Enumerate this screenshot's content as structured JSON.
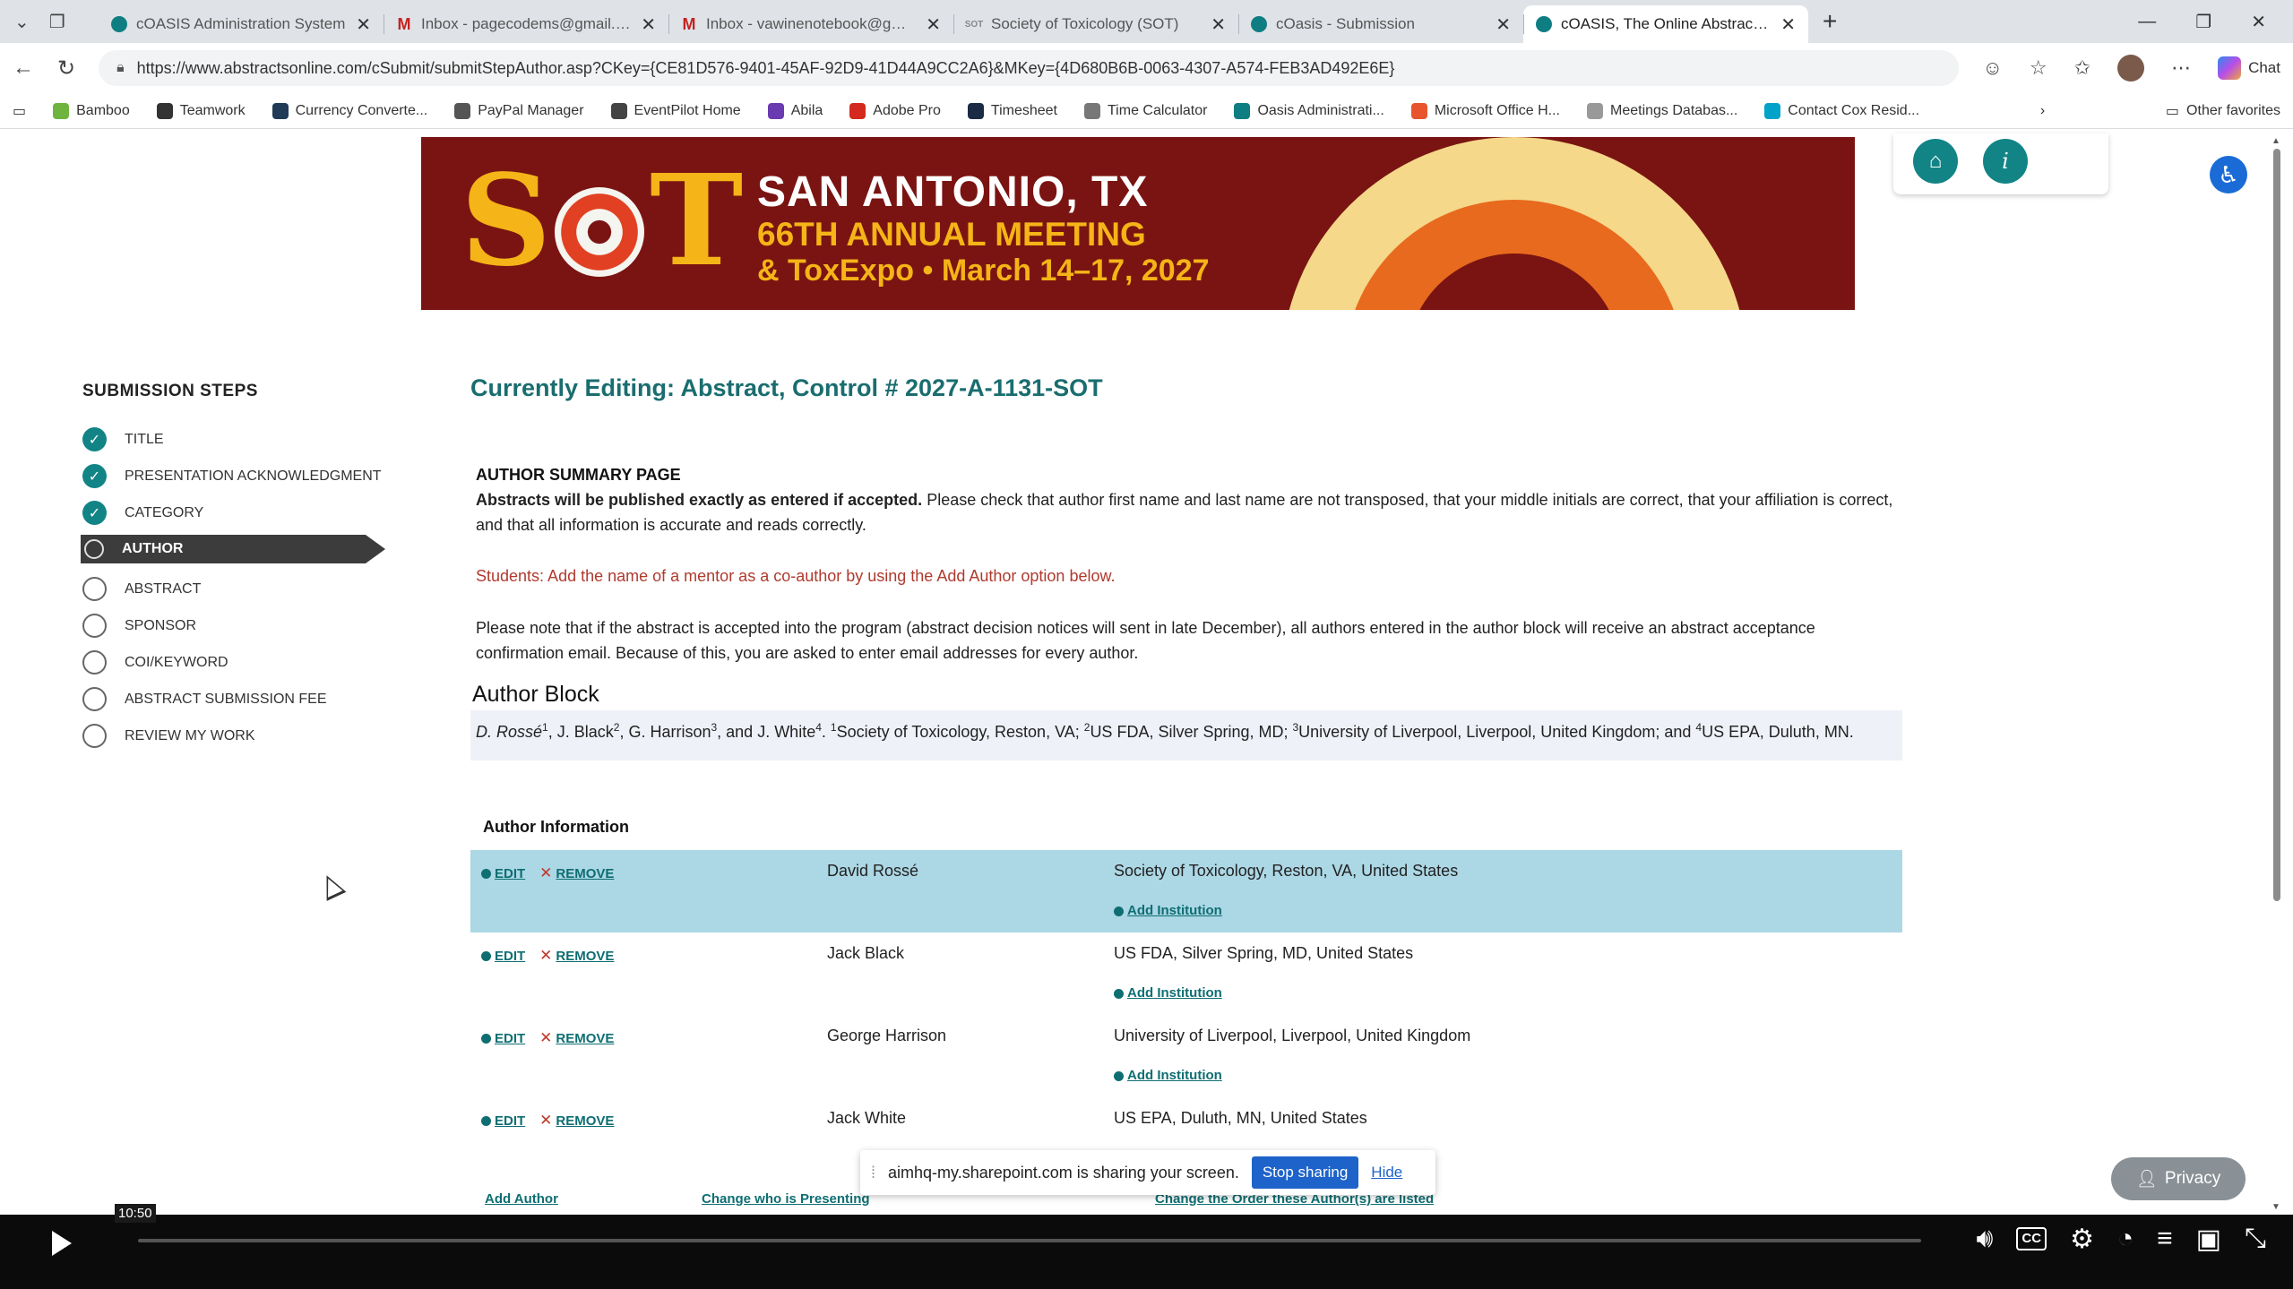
{
  "browser": {
    "tabs": [
      {
        "title": "cOASIS Administration System",
        "icon": "oasis-icon",
        "active": false
      },
      {
        "title": "Inbox - pagecodems@gmail.com",
        "icon": "gmail-icon",
        "active": false
      },
      {
        "title": "Inbox - vawinenotebook@gmail.c",
        "icon": "gmail-icon",
        "active": false
      },
      {
        "title": "Society of Toxicology (SOT)",
        "icon": "sot-icon",
        "active": false
      },
      {
        "title": "cOasis - Submission",
        "icon": "oasis-icon",
        "active": false
      },
      {
        "title": "cOASIS, The Online Abstract Subm",
        "icon": "oasis-icon",
        "active": true
      }
    ],
    "url": "https://www.abstractsonline.com/cSubmit/submitStepAuthor.asp?CKey={CE81D576-9401-45AF-92D9-41D44A9CC2A6}&MKey={4D680B6B-0063-4307-A574-FEB3AD492E6E}",
    "chat_label": "Chat",
    "bookmarks": [
      {
        "label": "Bamboo",
        "color": "#6fb43f"
      },
      {
        "label": "Teamwork",
        "color": "#333333"
      },
      {
        "label": "Currency Converte...",
        "color": "#1f3b57"
      },
      {
        "label": "PayPal Manager",
        "color": "#555555"
      },
      {
        "label": "EventPilot Home",
        "color": "#444444"
      },
      {
        "label": "Abila",
        "color": "#6a3bb0"
      },
      {
        "label": "Adobe Pro",
        "color": "#d4291e"
      },
      {
        "label": "Timesheet",
        "color": "#1c2b45"
      },
      {
        "label": "Time Calculator",
        "color": "#777777"
      },
      {
        "label": "Oasis Administrati...",
        "color": "#0f7e82"
      },
      {
        "label": "Microsoft Office H...",
        "color": "#e7542d"
      },
      {
        "label": "Meetings Databas...",
        "color": "#999999"
      },
      {
        "label": "Contact Cox Resid...",
        "color": "#00a2c8"
      }
    ],
    "other_favorites": "Other favorites"
  },
  "banner": {
    "logo": "SOT",
    "city": "SAN ANTONIO, TX",
    "meeting": "66TH ANNUAL MEETING",
    "expo": "& ToxExpo",
    "dates": "March 14–17, 2027"
  },
  "sidebar": {
    "heading": "SUBMISSION STEPS",
    "steps": [
      {
        "label": "TITLE",
        "status": "done"
      },
      {
        "label": "PRESENTATION ACKNOWLEDGMENT",
        "status": "done"
      },
      {
        "label": "CATEGORY",
        "status": "done"
      },
      {
        "label": "AUTHOR",
        "status": "current"
      },
      {
        "label": "ABSTRACT",
        "status": "todo"
      },
      {
        "label": "SPONSOR",
        "status": "todo"
      },
      {
        "label": "COI/KEYWORD",
        "status": "todo"
      },
      {
        "label": "ABSTRACT SUBMISSION FEE",
        "status": "todo"
      },
      {
        "label": "REVIEW MY WORK",
        "status": "todo"
      }
    ]
  },
  "main": {
    "editing": "Currently Editing: Abstract,  Control # 2027-A-1131-SOT",
    "summary_title": "AUTHOR SUMMARY PAGE",
    "notice_bold": "Abstracts will be published exactly as entered if accepted.",
    "notice_rest": " Please check that author first name and last name are not transposed, that your middle initials are correct, that your affiliation is correct, and that all information is accurate and reads correctly.",
    "students_note": "Students: Add the name of a mentor as a co-author by using the Add Author option below.",
    "email_note": "Please note that if the abstract is accepted into the program (abstract decision notices will sent in late December), all authors entered in the author block will receive an abstract acceptance confirmation email.  Because of this, you are asked to enter email addresses for every author.",
    "author_block_title": "Author Block",
    "author_block": {
      "a1": "D. Rossé",
      "a1s": "1",
      "a2": ", J. Black",
      "a2s": "2",
      "a3": ", G. Harrison",
      "a3s": "3",
      "a4": ", and J. White",
      "a4s": "4",
      "i1s": "1",
      "i1": "Society of Toxicology, Reston, VA; ",
      "i2s": "2",
      "i2": "US FDA, Silver Spring, MD; ",
      "i3s": "3",
      "i3": "University of Liverpool, Liverpool, United Kingdom; and ",
      "i4s": "4",
      "i4": "US EPA, Duluth, MN."
    },
    "author_info_title": "Author Information",
    "edit_label": "EDIT",
    "remove_label": "REMOVE",
    "add_institution_label": "Add Institution",
    "authors": [
      {
        "name": "David Rossé",
        "institution": "Society of Toxicology, Reston, VA, United States",
        "highlighted": true
      },
      {
        "name": "Jack Black",
        "institution": "US FDA, Silver Spring, MD, United States",
        "highlighted": false
      },
      {
        "name": "George Harrison",
        "institution": "University of Liverpool, Liverpool, United Kingdom",
        "highlighted": false
      },
      {
        "name": "Jack White",
        "institution": "US EPA, Duluth, MN, United States",
        "highlighted": false
      }
    ],
    "links": {
      "add_author": "Add Author",
      "change_presenting": "Change who is Presenting",
      "change_order": "Change the Order these Author(s) are listed"
    }
  },
  "share_bar": {
    "message": "aimhq-my.sharepoint.com is sharing your screen.",
    "stop": "Stop sharing",
    "hide": "Hide"
  },
  "privacy": "Privacy",
  "player": {
    "time": "10:50",
    "progress": 0.0
  }
}
